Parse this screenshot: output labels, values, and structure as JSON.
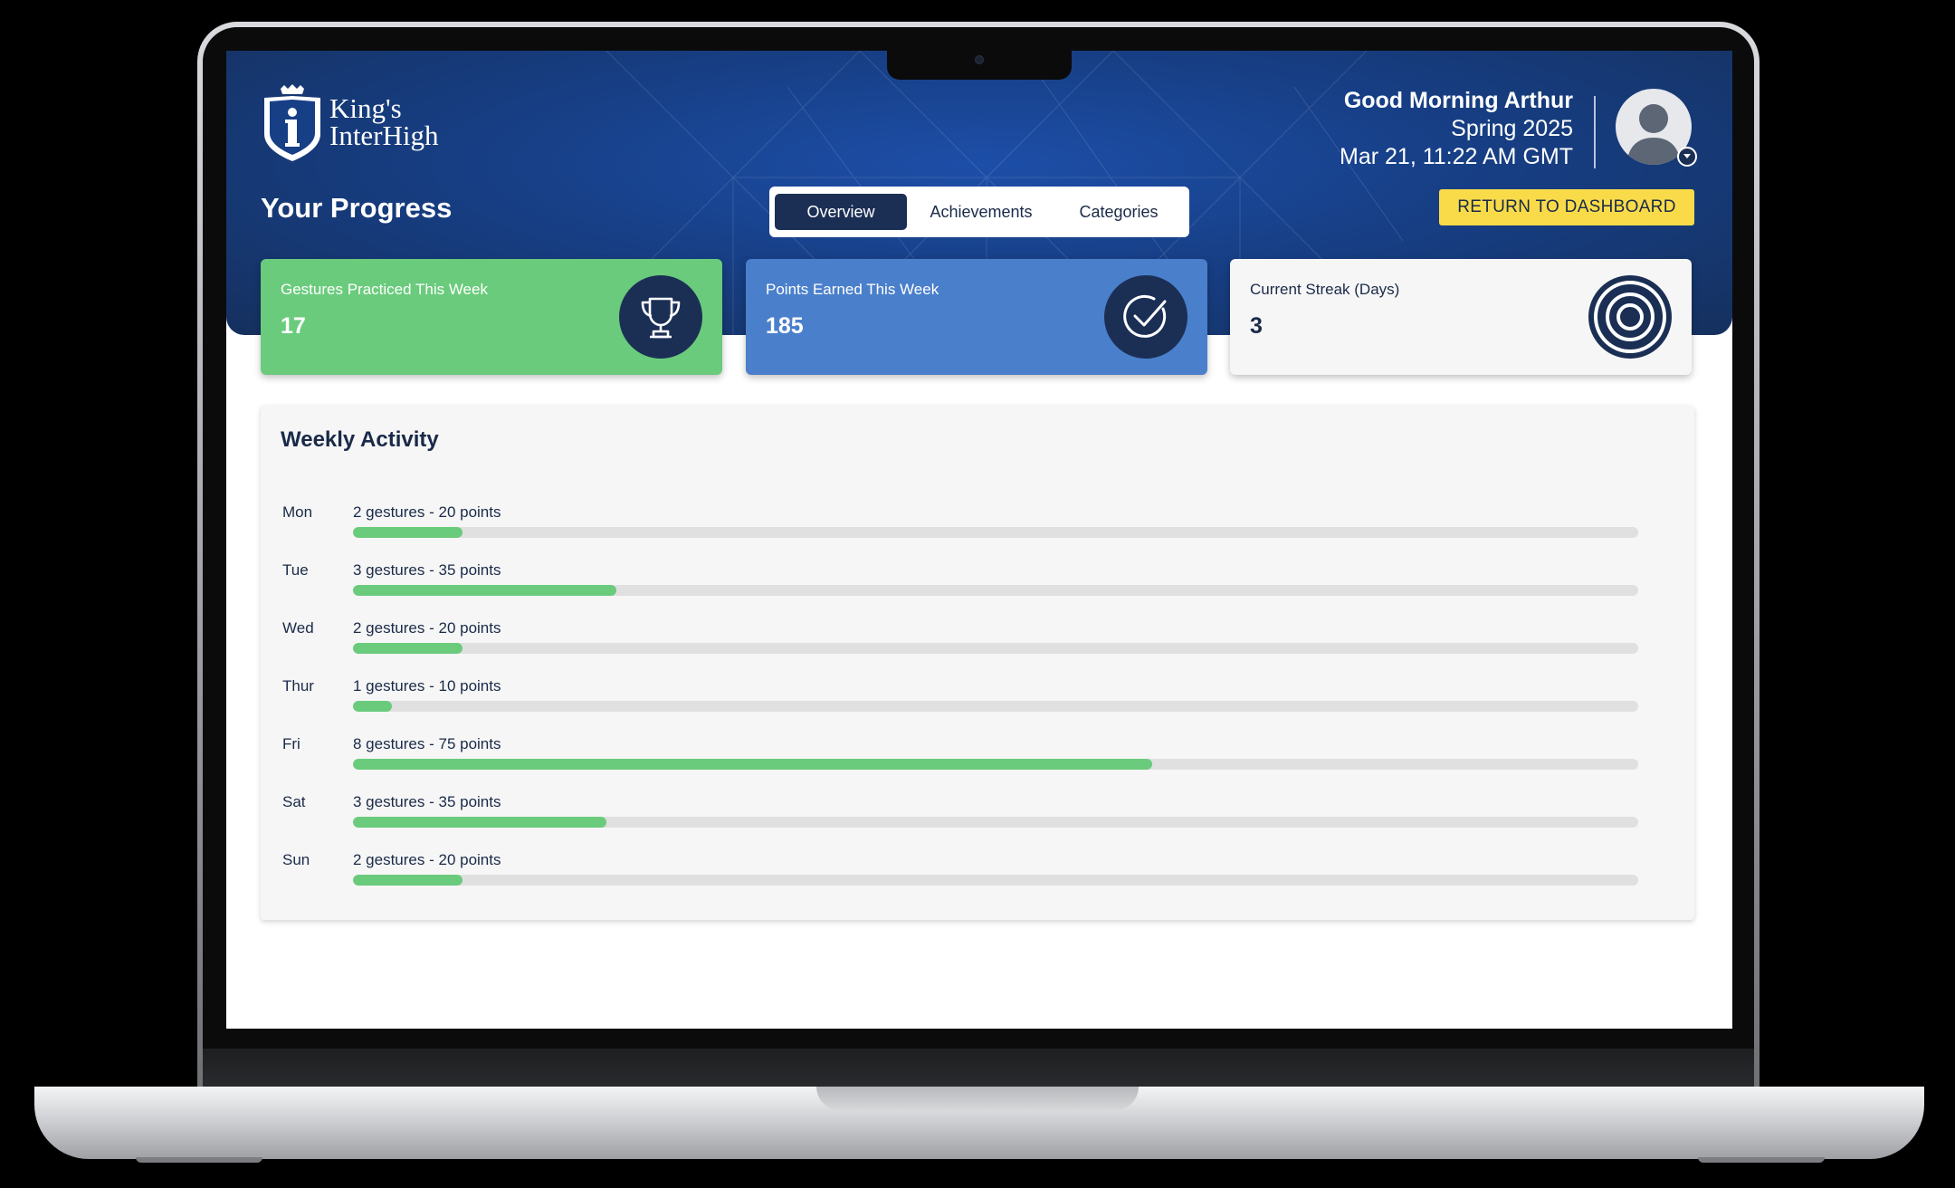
{
  "brand": {
    "logo_line1": "King's",
    "logo_line2": "InterHigh"
  },
  "header": {
    "greeting": "Good Morning Arthur",
    "term": "Spring 2025",
    "datetime": "Mar 21, 11:22 AM GMT",
    "page_title": "Your Progress",
    "return_button": "RETURN TO DASHBOARD"
  },
  "tabs": [
    {
      "label": "Overview",
      "active": true
    },
    {
      "label": "Achievements",
      "active": false
    },
    {
      "label": "Categories",
      "active": false
    }
  ],
  "stats": [
    {
      "label": "Gestures Practiced This Week",
      "value": "17",
      "icon": "trophy-icon",
      "color": "#6acb7c"
    },
    {
      "label": "Points Earned This Week",
      "value": "185",
      "icon": "check-circle-icon",
      "color": "#4a7fcb"
    },
    {
      "label": "Current Streak (Days)",
      "value": "3",
      "icon": "target-icon",
      "color": "#f6f6f6"
    }
  ],
  "weekly_activity": {
    "title": "Weekly Activity",
    "days": [
      {
        "day": "Mon",
        "summary": "2 gestures - 20 points",
        "progress": 0.085
      },
      {
        "day": "Tue",
        "summary": "3 gestures - 35 points",
        "progress": 0.205
      },
      {
        "day": "Wed",
        "summary": "2 gestures - 20 points",
        "progress": 0.085
      },
      {
        "day": "Thur",
        "summary": "1 gestures - 10 points",
        "progress": 0.03
      },
      {
        "day": "Fri",
        "summary": "8 gestures - 75 points",
        "progress": 0.622
      },
      {
        "day": "Sat",
        "summary": "3 gestures - 35 points",
        "progress": 0.197
      },
      {
        "day": "Sun",
        "summary": "2 gestures - 20 points",
        "progress": 0.085
      }
    ]
  },
  "colors": {
    "header_blue": "#173f86",
    "accent_yellow": "#f9db4a",
    "progress_green": "#6acb7c",
    "navy": "#1b2f55"
  }
}
